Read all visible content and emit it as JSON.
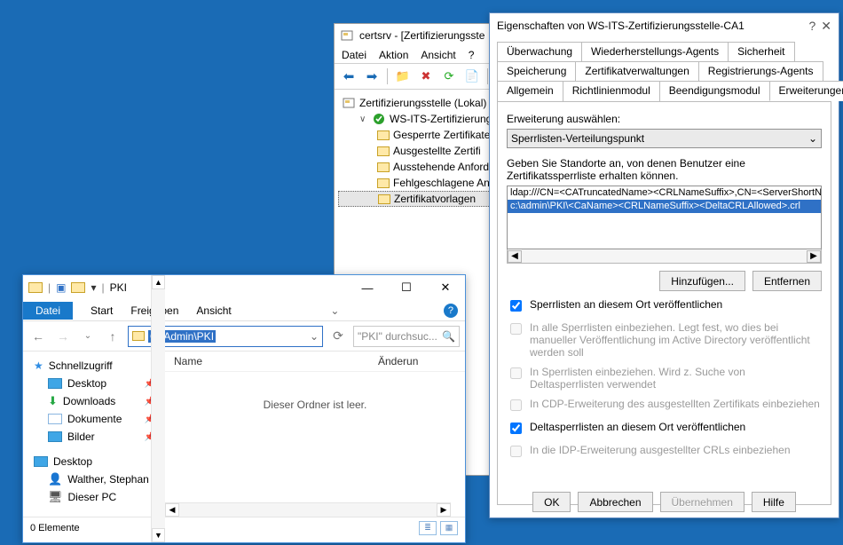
{
  "certsrv": {
    "title": "certsrv - [Zertifizierungsste",
    "menu": {
      "file": "Datei",
      "action": "Aktion",
      "view": "Ansicht",
      "help": "?"
    },
    "tree": {
      "root": "Zertifizierungsstelle (Lokal)",
      "ca": "WS-ITS-Zertifizierungsst",
      "children": [
        "Gesperrte Zertifikate",
        "Ausgestellte Zertifi",
        "Ausstehende Anforde",
        "Fehlgeschlagene Anfo",
        "Zertifikatvorlagen"
      ]
    }
  },
  "props": {
    "title": "Eigenschaften von WS-ITS-Zertifizierungsstelle-CA1",
    "tab_row1": [
      "Überwachung",
      "Wiederherstellungs-Agents",
      "Sicherheit"
    ],
    "tab_row2": [
      "Speicherung",
      "Zertifikatverwaltungen",
      "Registrierungs-Agents"
    ],
    "tab_row3": [
      "Allgemein",
      "Richtlinienmodul",
      "Beendigungsmodul",
      "Erweiterungen"
    ],
    "active_tab": "Erweiterungen",
    "ext_label": "Erweiterung auswählen:",
    "ext_value": "Sperrlisten-Verteilungspunkt",
    "loc_label": "Geben Sie Standorte an, von denen Benutzer eine Zertifikatssperrliste erhalten können.",
    "list": {
      "r1": "ldap:///CN=<CATruncatedName><CRLNameSuffix>,CN=<ServerShortNam",
      "r2": "c:\\admin\\PKI\\<CaName><CRLNameSuffix><DeltaCRLAllowed>.crl"
    },
    "add_btn": "Hinzufügen...",
    "remove_btn": "Entfernen",
    "checks": {
      "c1": "Sperrlisten an diesem Ort veröffentlichen",
      "c2": "In alle Sperrlisten einbeziehen. Legt fest, wo dies bei manueller Veröffentlichung im Active Directory veröffentlicht werden soll",
      "c3": "In Sperrlisten einbeziehen. Wird z. Suche von Deltasperrlisten verwendet",
      "c4": "In CDP-Erweiterung des ausgestellten Zertifikats einbeziehen",
      "c5": "Deltasperrlisten an diesem Ort veröffentlichen",
      "c6": "In die IDP-Erweiterung ausgestellter CRLs einbeziehen"
    },
    "footer": {
      "ok": "OK",
      "cancel": "Abbrechen",
      "apply": "Übernehmen",
      "help": "Hilfe"
    }
  },
  "explorer": {
    "title": "PKI",
    "ribbon": {
      "file": "Datei",
      "start": "Start",
      "share": "Freigeben",
      "view": "Ansicht"
    },
    "address": "C:\\Admin\\PKI",
    "search_placeholder": "\"PKI\" durchsuc...",
    "columns": {
      "name": "Name",
      "modified": "Änderun"
    },
    "empty_msg": "Dieser Ordner ist leer.",
    "sidebar": {
      "quick": "Schnellzugriff",
      "desktop": "Desktop",
      "downloads": "Downloads",
      "documents": "Dokumente",
      "pictures": "Bilder",
      "desktop2": "Desktop",
      "user": "Walther, Stephan",
      "pc": "Dieser PC"
    },
    "status": "0 Elemente"
  }
}
